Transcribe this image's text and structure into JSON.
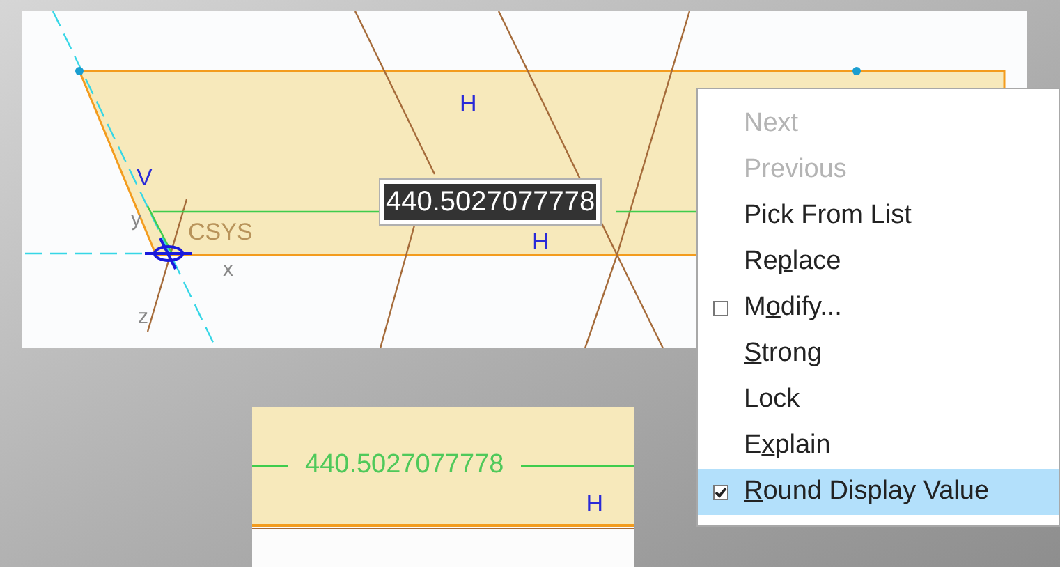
{
  "sketch_view": {
    "horizontal_marks": [
      "H",
      "H"
    ],
    "vertical_mark": "V",
    "csys_label": "CSYS",
    "axis_labels": {
      "x": "x",
      "y": "y",
      "z": "z"
    },
    "dimension_field": {
      "value": "440.5027077778",
      "selected": true
    }
  },
  "detail_view": {
    "dimension": "440.5027077778",
    "horizontal_mark": "H"
  },
  "context_menu": {
    "items": [
      {
        "kind": "command",
        "before": "Next",
        "disabled": true,
        "selected": false
      },
      {
        "kind": "command",
        "before": "Previous",
        "disabled": true,
        "selected": false
      },
      {
        "kind": "command",
        "before": "Pick From List",
        "disabled": false,
        "selected": false
      },
      {
        "kind": "command",
        "before": "Re",
        "key": "p",
        "after": "lace",
        "disabled": false,
        "selected": false
      },
      {
        "kind": "toggle",
        "before": "M",
        "key": "o",
        "after": "dify...",
        "checked": false,
        "disabled": false,
        "selected": false
      },
      {
        "kind": "command",
        "key": "S",
        "after": "trong",
        "disabled": false,
        "selected": false
      },
      {
        "kind": "command",
        "before": "Lock",
        "disabled": false,
        "selected": false
      },
      {
        "kind": "command",
        "before": "E",
        "key": "x",
        "after": "plain",
        "disabled": false,
        "selected": false
      },
      {
        "kind": "toggle",
        "key": "R",
        "after": "ound Display Value",
        "checked": true,
        "disabled": false,
        "selected": true
      }
    ]
  }
}
